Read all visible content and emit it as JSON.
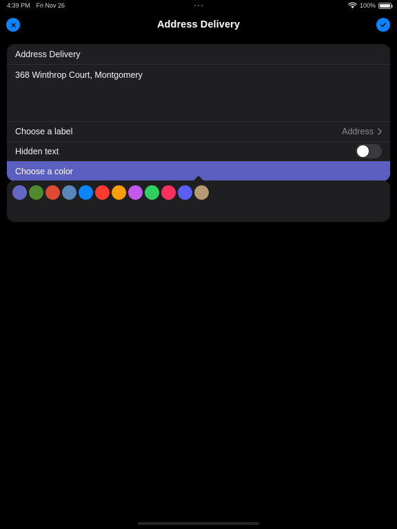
{
  "status_bar": {
    "time": "4:39 PM",
    "date": "Fri Nov 26",
    "battery_percent": "100%",
    "wifi_icon": "wifi-icon",
    "battery_icon": "battery-icon",
    "multitask_indicator": "three-dots-icon"
  },
  "nav_bar": {
    "title": "Address Delivery",
    "close_icon": "close-x-icon",
    "done_icon": "checkmark-icon"
  },
  "card": {
    "section_title": "Address Delivery",
    "address_value": "368 Winthrop Court, Montgomery",
    "address_placeholder": "Address",
    "label_row": {
      "label": "Choose a label",
      "value": "Address",
      "chevron_icon": "chevron-right-icon"
    },
    "hidden_row": {
      "label": "Hidden text",
      "toggle_state": "off"
    },
    "color_row": {
      "label": "Choose a color",
      "highlight_color": "#5a5fc0"
    }
  },
  "color_picker": {
    "swatches": [
      {
        "name": "indigo",
        "hex": "#6268c4"
      },
      {
        "name": "olive-green",
        "hex": "#4f8b2e"
      },
      {
        "name": "red-orange",
        "hex": "#dc4b32"
      },
      {
        "name": "steel-blue",
        "hex": "#5a87bb"
      },
      {
        "name": "blue",
        "hex": "#0a84ff"
      },
      {
        "name": "red",
        "hex": "#fb3b30"
      },
      {
        "name": "orange",
        "hex": "#fb9e0b"
      },
      {
        "name": "violet",
        "hex": "#c358ef"
      },
      {
        "name": "green",
        "hex": "#2fd060"
      },
      {
        "name": "pink",
        "hex": "#fb305f"
      },
      {
        "name": "blue-violet",
        "hex": "#5a5ef4"
      },
      {
        "name": "tan",
        "hex": "#b59a74"
      }
    ]
  },
  "colors": {
    "accent_blue": "#0a84ff",
    "card_background": "#1f1f21",
    "page_background": "#000000",
    "highlight": "#5a5fc0"
  }
}
